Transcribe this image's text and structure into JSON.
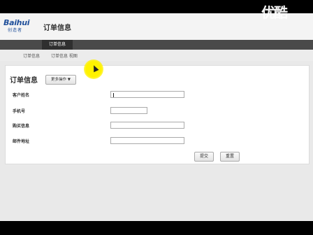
{
  "header": {
    "logo_text": "Baihui",
    "logo_sub": "创造者",
    "title": "订单信息",
    "watermark": "优酷"
  },
  "navbar": {
    "active_tab": "订单信息"
  },
  "subnav": {
    "items": [
      "订单信息",
      "订单信息 视图"
    ]
  },
  "form": {
    "title": "订单信息",
    "more_actions": "更多操作 ▼",
    "fields": [
      {
        "label": "客户姓名",
        "value": ""
      },
      {
        "label": "手机号",
        "value": ""
      },
      {
        "label": "购买信息",
        "value": ""
      },
      {
        "label": "邮件地址",
        "value": ""
      }
    ],
    "submit": "提交",
    "reset": "重置"
  },
  "colors": {
    "navbar": "#4a4a4a",
    "brand_blue": "#1f4f9a",
    "brand_red": "#d63a2a",
    "cursor_highlight": "#fff200"
  }
}
